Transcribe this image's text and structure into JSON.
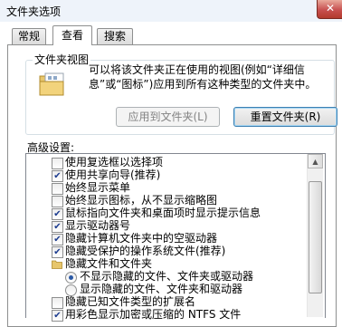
{
  "window": {
    "title": "文件夹选项",
    "close_glyph": "✕"
  },
  "tabs": [
    {
      "label": "常规"
    },
    {
      "label": "查看"
    },
    {
      "label": "搜索"
    }
  ],
  "folder_views": {
    "legend": "文件夹视图",
    "description": "可以将该文件夹正在使用的视图(例如“详细信息”或“图标”)应用到所有这种类型的文件夹中。",
    "apply_button": "应用到文件夹(L)",
    "reset_button": "重置文件夹(R)"
  },
  "advanced": {
    "label": "高级设置:",
    "items": [
      {
        "label": "使用复选框以选择项",
        "type": "checkbox",
        "checked": false
      },
      {
        "label": "使用共享向导(推荐)",
        "type": "checkbox",
        "checked": true
      },
      {
        "label": "始终显示菜单",
        "type": "checkbox",
        "checked": false
      },
      {
        "label": "始终显示图标，从不显示缩略图",
        "type": "checkbox",
        "checked": false
      },
      {
        "label": "鼠标指向文件夹和桌面项时显示提示信息",
        "type": "checkbox",
        "checked": true
      },
      {
        "label": "显示驱动器号",
        "type": "checkbox",
        "checked": true
      },
      {
        "label": "隐藏计算机文件夹中的空驱动器",
        "type": "checkbox",
        "checked": true
      },
      {
        "label": "隐藏受保护的操作系统文件(推荐)",
        "type": "checkbox",
        "checked": true
      },
      {
        "label": "隐藏文件和文件夹",
        "type": "folder"
      },
      {
        "label": "不显示隐藏的文件、文件夹或驱动器",
        "type": "radio",
        "checked": true
      },
      {
        "label": "显示隐藏的文件、文件夹和驱动器",
        "type": "radio",
        "checked": false
      },
      {
        "label": "隐藏已知文件类型的扩展名",
        "type": "checkbox",
        "checked": false
      },
      {
        "label": "用彩色显示加密或压缩的 NTFS 文件",
        "type": "checkbox",
        "checked": true
      }
    ]
  }
}
